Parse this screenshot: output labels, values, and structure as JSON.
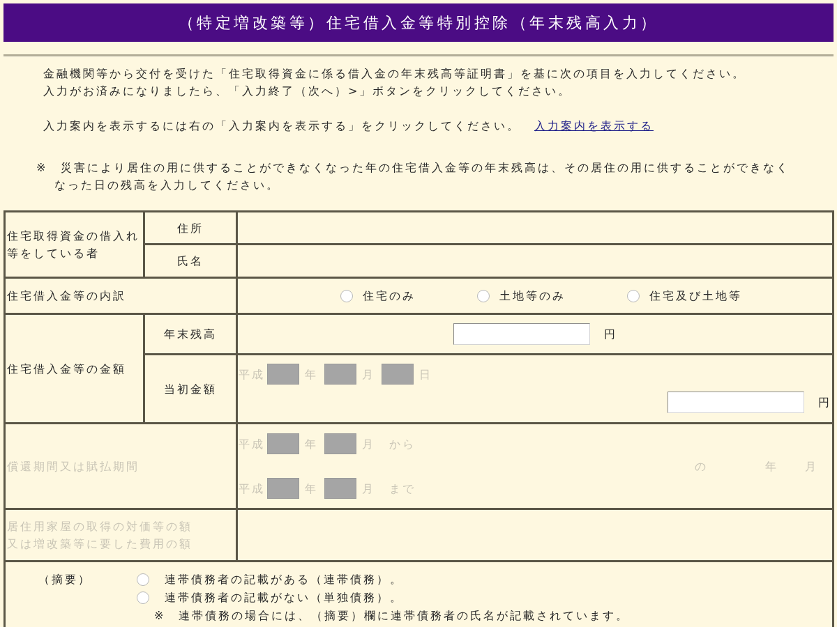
{
  "title": "（特定増改築等）住宅借入金等特別控除（年末残高入力）",
  "instructions": [
    "金融機関等から交付を受けた「住宅取得資金に係る借入金の年末残高等証明書」を基に次の項目を入力してください。",
    "入力がお済みになりましたら、「入力終了（次へ）>」ボタンをクリックしてください。"
  ],
  "guide": {
    "text": "入力案内を表示するには右の「入力案内を表示する」をクリックしてください。",
    "link": "入力案内を表示する"
  },
  "note": {
    "lines": [
      "※　災害により居住の用に供することができなくなった年の住宅借入金等の年末残高は、その居住の用に供することができなく",
      "なった日の残高を入力してください。"
    ]
  },
  "form": {
    "borrower": {
      "lines": [
        "住宅取得資金の借入れ",
        "等をしている者"
      ],
      "rows": [
        {
          "label": "住所"
        },
        {
          "label": "氏名"
        }
      ]
    },
    "breakdown": {
      "label": "住宅借入金等の内訳",
      "options": [
        {
          "label": "住宅のみ",
          "selected": false
        },
        {
          "label": "土地等のみ",
          "selected": false
        },
        {
          "label": "住宅及び土地等",
          "selected": false
        }
      ]
    },
    "amount": {
      "label": "住宅借入金等の金額",
      "year_end": {
        "label": "年末残高",
        "unit": "円"
      },
      "initial": {
        "label": "当初金額",
        "date": {
          "disabled": true,
          "era": "平成",
          "units": [
            "年",
            "月",
            "日"
          ]
        },
        "unit": "円"
      }
    },
    "period": {
      "label": "償還期間又は賦払期間",
      "disabled": true,
      "from": {
        "era": "平成",
        "units": [
          "年",
          "月"
        ],
        "suffix": "から"
      },
      "to": {
        "era": "平成",
        "units": [
          "年",
          "月"
        ],
        "suffix": "まで"
      },
      "duration": [
        "の",
        "年",
        "月"
      ]
    },
    "cost": {
      "lines": [
        "居住用家屋の取得の対価等の額",
        "又は増改築等に要した費用の額"
      ],
      "disabled": true
    },
    "remarks": {
      "label": "（摘要）",
      "options": [
        {
          "label": "連帯債務者の記載がある（連帯債務）。",
          "selected": false
        },
        {
          "label": "連帯債務者の記載がない（単独債務）。",
          "selected": false
        }
      ],
      "note": "※　連帯債務の場合には、（摘要）欄に連帯債務者の氏名が記載されています。"
    }
  }
}
